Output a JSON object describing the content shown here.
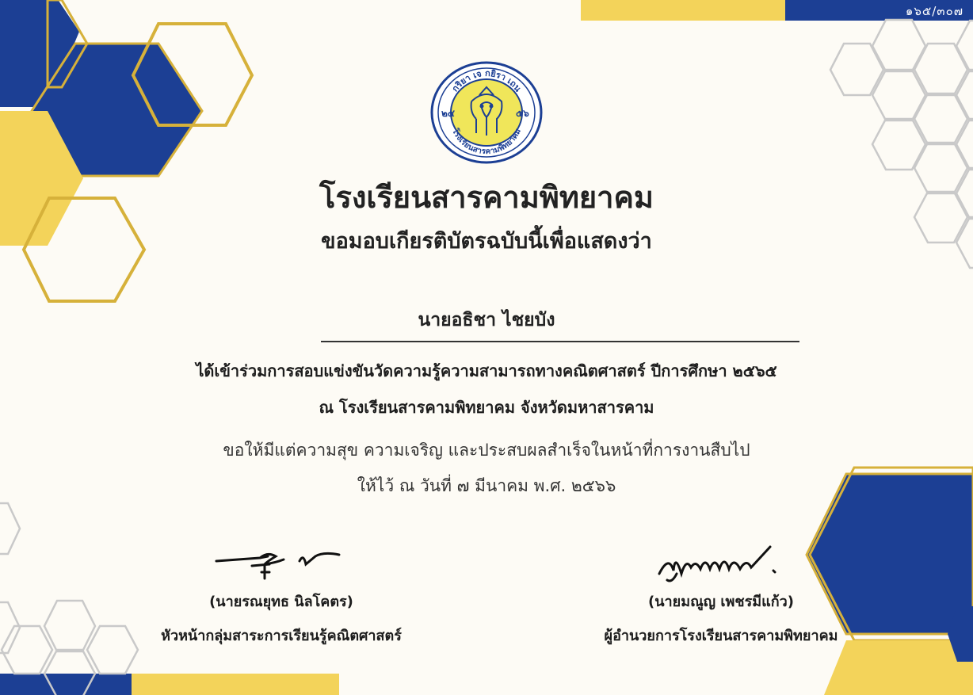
{
  "certificate": {
    "serial": "๑๖๕/๓๐๗",
    "school_name": "โรงเรียนสารคามพิทยาคม",
    "presentation": "ขอมอบเกียรติบัตรฉบับนี้เพื่อแสดงว่า",
    "recipient_name": "นายอธิชา ไชยบัง",
    "body_line_1": "ได้เข้าร่วมการสอบแข่งขันวัดความรู้ความสามารถทางคณิตศาสตร์ ปีการศึกษา ๒๕๖๕",
    "body_line_2": "ณ โรงเรียนสารคามพิทยาคม จังหวัดมหาสารคาม",
    "wish": "ขอให้มีแต่ความสุข ความเจริญ และประสบผลสำเร็จในหน้าที่การงานสืบไป",
    "given_date": "ให้ไว้ ณ วันที่ ๗ มีนาคม พ.ศ. ๒๕๖๖"
  },
  "logo": {
    "motto": "กริยา เจ กยิรา เถน",
    "left_number": "๒๔",
    "right_number": "๕๖",
    "bottom_text": "โรงเรียนสารคามพิทยาคม"
  },
  "signatories": [
    {
      "name": "(นายรณยุทธ นิลโคตร)",
      "role": "หัวหน้ากลุ่มสาระการเรียนรู้คณิตศาสตร์"
    },
    {
      "name": "(นายมณูญ เพชรมีแก้ว)",
      "role": "ผู้อำนวยการโรงเรียนสารคามพิทยาคม"
    }
  ],
  "colors": {
    "navy": "#1c3f94",
    "gold": "#f3d35a",
    "hex_outline_gold": "#d6b13a",
    "background": "#fdfbf5"
  }
}
